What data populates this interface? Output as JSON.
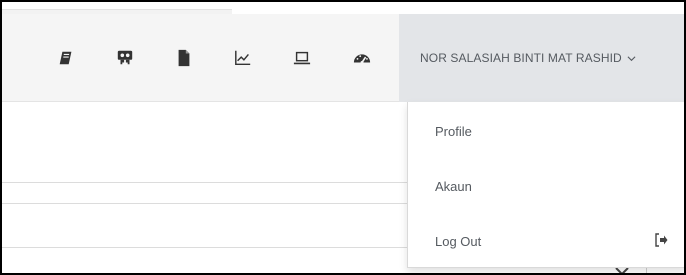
{
  "navbar": {
    "icons": [
      {
        "name": "book-icon"
      },
      {
        "name": "slideshare-icon"
      },
      {
        "name": "file-icon"
      },
      {
        "name": "line-chart-icon"
      },
      {
        "name": "laptop-icon"
      },
      {
        "name": "dashboard-icon"
      }
    ],
    "user_name": "NOR SALASIAH BINTI MAT RASHID",
    "caret_icon": "chevron-down-icon"
  },
  "dropdown": {
    "items": [
      {
        "label": "Profile"
      },
      {
        "label": "Akaun"
      },
      {
        "label": "Log Out",
        "icon": "sign-out-icon"
      }
    ]
  },
  "colors": {
    "navbar_bg": "#f5f5f5",
    "user_menu_bg": "#e3e5e8",
    "text": "#555a60"
  }
}
